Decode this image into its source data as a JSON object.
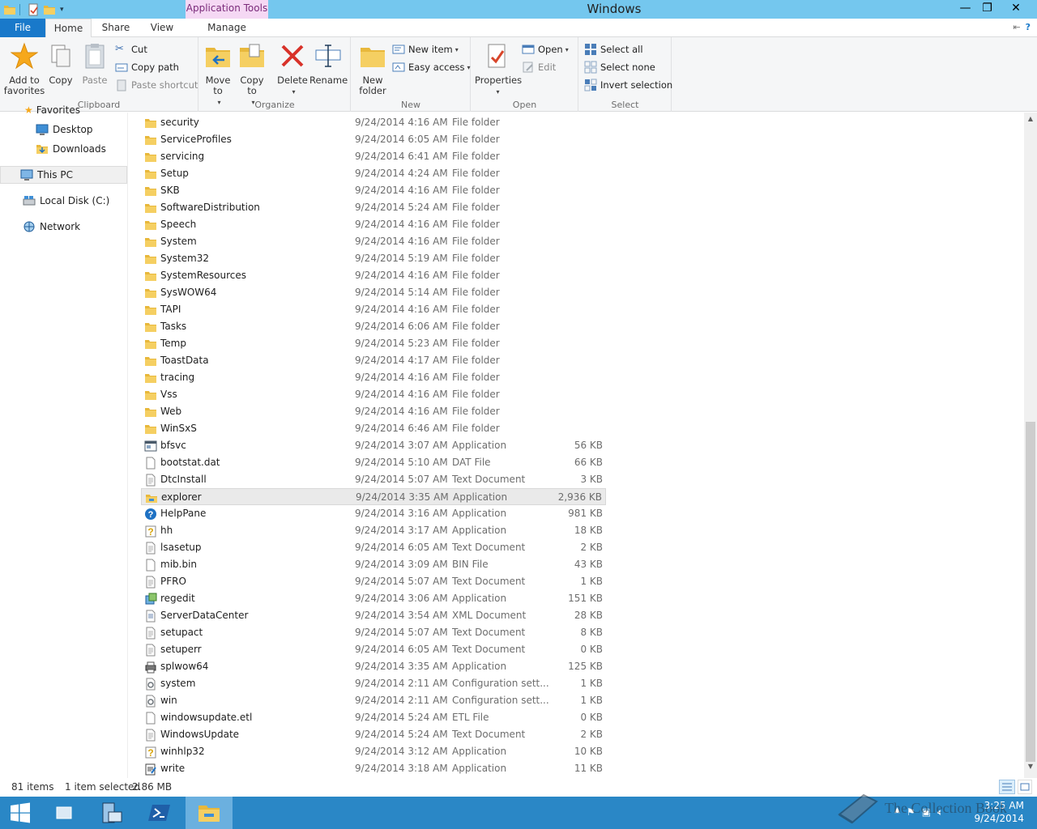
{
  "window": {
    "title": "Windows",
    "context_tab_group": "Application Tools",
    "controls": {
      "minimize": "—",
      "maximize": "❐",
      "close": "✕"
    }
  },
  "ribbon_tabs": {
    "file": "File",
    "home": "Home",
    "share": "Share",
    "view": "View",
    "manage": "Manage"
  },
  "ribbon": {
    "clipboard": {
      "label": "Clipboard",
      "add_favorites": "Add to favorites",
      "copy": "Copy",
      "paste": "Paste",
      "cut": "Cut",
      "copy_path": "Copy path",
      "paste_shortcut": "Paste shortcut"
    },
    "organize": {
      "label": "Organize",
      "move_to": "Move to",
      "copy_to": "Copy to",
      "delete": "Delete",
      "rename": "Rename"
    },
    "new": {
      "label": "New",
      "new_folder": "New folder",
      "new_item": "New item",
      "easy_access": "Easy access"
    },
    "open": {
      "label": "Open",
      "properties": "Properties",
      "open": "Open",
      "edit": "Edit"
    },
    "select": {
      "label": "Select",
      "select_all": "Select all",
      "select_none": "Select none",
      "invert_selection": "Invert selection"
    }
  },
  "nav": {
    "favorites_partial": "Favorites",
    "items": [
      {
        "label": "Desktop"
      },
      {
        "label": "Downloads"
      },
      {
        "label": "This PC"
      },
      {
        "label": "Local Disk (C:)"
      },
      {
        "label": "Network"
      }
    ]
  },
  "files": [
    {
      "name": "security",
      "date": "9/24/2014 4:16 AM",
      "type": "File folder",
      "size": "",
      "icon": "folder-icon"
    },
    {
      "name": "ServiceProfiles",
      "date": "9/24/2014 6:05 AM",
      "type": "File folder",
      "size": "",
      "icon": "folder-icon"
    },
    {
      "name": "servicing",
      "date": "9/24/2014 6:41 AM",
      "type": "File folder",
      "size": "",
      "icon": "folder-icon"
    },
    {
      "name": "Setup",
      "date": "9/24/2014 4:24 AM",
      "type": "File folder",
      "size": "",
      "icon": "folder-icon"
    },
    {
      "name": "SKB",
      "date": "9/24/2014 4:16 AM",
      "type": "File folder",
      "size": "",
      "icon": "folder-icon"
    },
    {
      "name": "SoftwareDistribution",
      "date": "9/24/2014 5:24 AM",
      "type": "File folder",
      "size": "",
      "icon": "folder-icon"
    },
    {
      "name": "Speech",
      "date": "9/24/2014 4:16 AM",
      "type": "File folder",
      "size": "",
      "icon": "folder-icon"
    },
    {
      "name": "System",
      "date": "9/24/2014 4:16 AM",
      "type": "File folder",
      "size": "",
      "icon": "folder-icon"
    },
    {
      "name": "System32",
      "date": "9/24/2014 5:19 AM",
      "type": "File folder",
      "size": "",
      "icon": "folder-icon"
    },
    {
      "name": "SystemResources",
      "date": "9/24/2014 4:16 AM",
      "type": "File folder",
      "size": "",
      "icon": "folder-icon"
    },
    {
      "name": "SysWOW64",
      "date": "9/24/2014 5:14 AM",
      "type": "File folder",
      "size": "",
      "icon": "folder-icon"
    },
    {
      "name": "TAPI",
      "date": "9/24/2014 4:16 AM",
      "type": "File folder",
      "size": "",
      "icon": "folder-icon"
    },
    {
      "name": "Tasks",
      "date": "9/24/2014 6:06 AM",
      "type": "File folder",
      "size": "",
      "icon": "folder-icon"
    },
    {
      "name": "Temp",
      "date": "9/24/2014 5:23 AM",
      "type": "File folder",
      "size": "",
      "icon": "folder-icon"
    },
    {
      "name": "ToastData",
      "date": "9/24/2014 4:17 AM",
      "type": "File folder",
      "size": "",
      "icon": "folder-icon"
    },
    {
      "name": "tracing",
      "date": "9/24/2014 4:16 AM",
      "type": "File folder",
      "size": "",
      "icon": "folder-icon"
    },
    {
      "name": "Vss",
      "date": "9/24/2014 4:16 AM",
      "type": "File folder",
      "size": "",
      "icon": "folder-icon"
    },
    {
      "name": "Web",
      "date": "9/24/2014 4:16 AM",
      "type": "File folder",
      "size": "",
      "icon": "folder-icon"
    },
    {
      "name": "WinSxS",
      "date": "9/24/2014 6:46 AM",
      "type": "File folder",
      "size": "",
      "icon": "folder-icon"
    },
    {
      "name": "bfsvc",
      "date": "9/24/2014 3:07 AM",
      "type": "Application",
      "size": "56 KB",
      "icon": "app-icon"
    },
    {
      "name": "bootstat.dat",
      "date": "9/24/2014 5:10 AM",
      "type": "DAT File",
      "size": "66 KB",
      "icon": "file-icon"
    },
    {
      "name": "DtcInstall",
      "date": "9/24/2014 5:07 AM",
      "type": "Text Document",
      "size": "3 KB",
      "icon": "text-file-icon"
    },
    {
      "name": "explorer",
      "date": "9/24/2014 3:35 AM",
      "type": "Application",
      "size": "2,936 KB",
      "icon": "explorer-icon",
      "selected": true
    },
    {
      "name": "HelpPane",
      "date": "9/24/2014 3:16 AM",
      "type": "Application",
      "size": "981 KB",
      "icon": "help-icon"
    },
    {
      "name": "hh",
      "date": "9/24/2014 3:17 AM",
      "type": "Application",
      "size": "18 KB",
      "icon": "help-file-icon"
    },
    {
      "name": "lsasetup",
      "date": "9/24/2014 6:05 AM",
      "type": "Text Document",
      "size": "2 KB",
      "icon": "text-file-icon"
    },
    {
      "name": "mib.bin",
      "date": "9/24/2014 3:09 AM",
      "type": "BIN File",
      "size": "43 KB",
      "icon": "file-icon"
    },
    {
      "name": "PFRO",
      "date": "9/24/2014 5:07 AM",
      "type": "Text Document",
      "size": "1 KB",
      "icon": "text-file-icon"
    },
    {
      "name": "regedit",
      "date": "9/24/2014 3:06 AM",
      "type": "Application",
      "size": "151 KB",
      "icon": "regedit-icon"
    },
    {
      "name": "ServerDataCenter",
      "date": "9/24/2014 3:54 AM",
      "type": "XML Document",
      "size": "28 KB",
      "icon": "xml-file-icon"
    },
    {
      "name": "setupact",
      "date": "9/24/2014 5:07 AM",
      "type": "Text Document",
      "size": "8 KB",
      "icon": "text-file-icon"
    },
    {
      "name": "setuperr",
      "date": "9/24/2014 6:05 AM",
      "type": "Text Document",
      "size": "0 KB",
      "icon": "text-file-icon"
    },
    {
      "name": "splwow64",
      "date": "9/24/2014 3:35 AM",
      "type": "Application",
      "size": "125 KB",
      "icon": "printer-icon"
    },
    {
      "name": "system",
      "date": "9/24/2014 2:11 AM",
      "type": "Configuration sett...",
      "size": "1 KB",
      "icon": "config-file-icon"
    },
    {
      "name": "win",
      "date": "9/24/2014 2:11 AM",
      "type": "Configuration sett...",
      "size": "1 KB",
      "icon": "config-file-icon"
    },
    {
      "name": "windowsupdate.etl",
      "date": "9/24/2014 5:24 AM",
      "type": "ETL File",
      "size": "0 KB",
      "icon": "file-icon"
    },
    {
      "name": "WindowsUpdate",
      "date": "9/24/2014 5:24 AM",
      "type": "Text Document",
      "size": "2 KB",
      "icon": "text-file-icon"
    },
    {
      "name": "winhlp32",
      "date": "9/24/2014 3:12 AM",
      "type": "Application",
      "size": "10 KB",
      "icon": "help-file-icon"
    },
    {
      "name": "write",
      "date": "9/24/2014 3:18 AM",
      "type": "Application",
      "size": "11 KB",
      "icon": "write-icon"
    }
  ],
  "status": {
    "item_count": "81 items",
    "selection": "1 item selected",
    "selection_size": "2.86 MB"
  },
  "taskbar": {
    "time": "3:25 AM",
    "date": "9/24/2014",
    "watermark": "The Collection Book"
  },
  "colors": {
    "titlebar": "#74c7ee",
    "file_tab": "#1979ca",
    "context_tab": "#f5d8f4",
    "taskbar": "#2a87c6",
    "folder": "#e8b83c"
  }
}
